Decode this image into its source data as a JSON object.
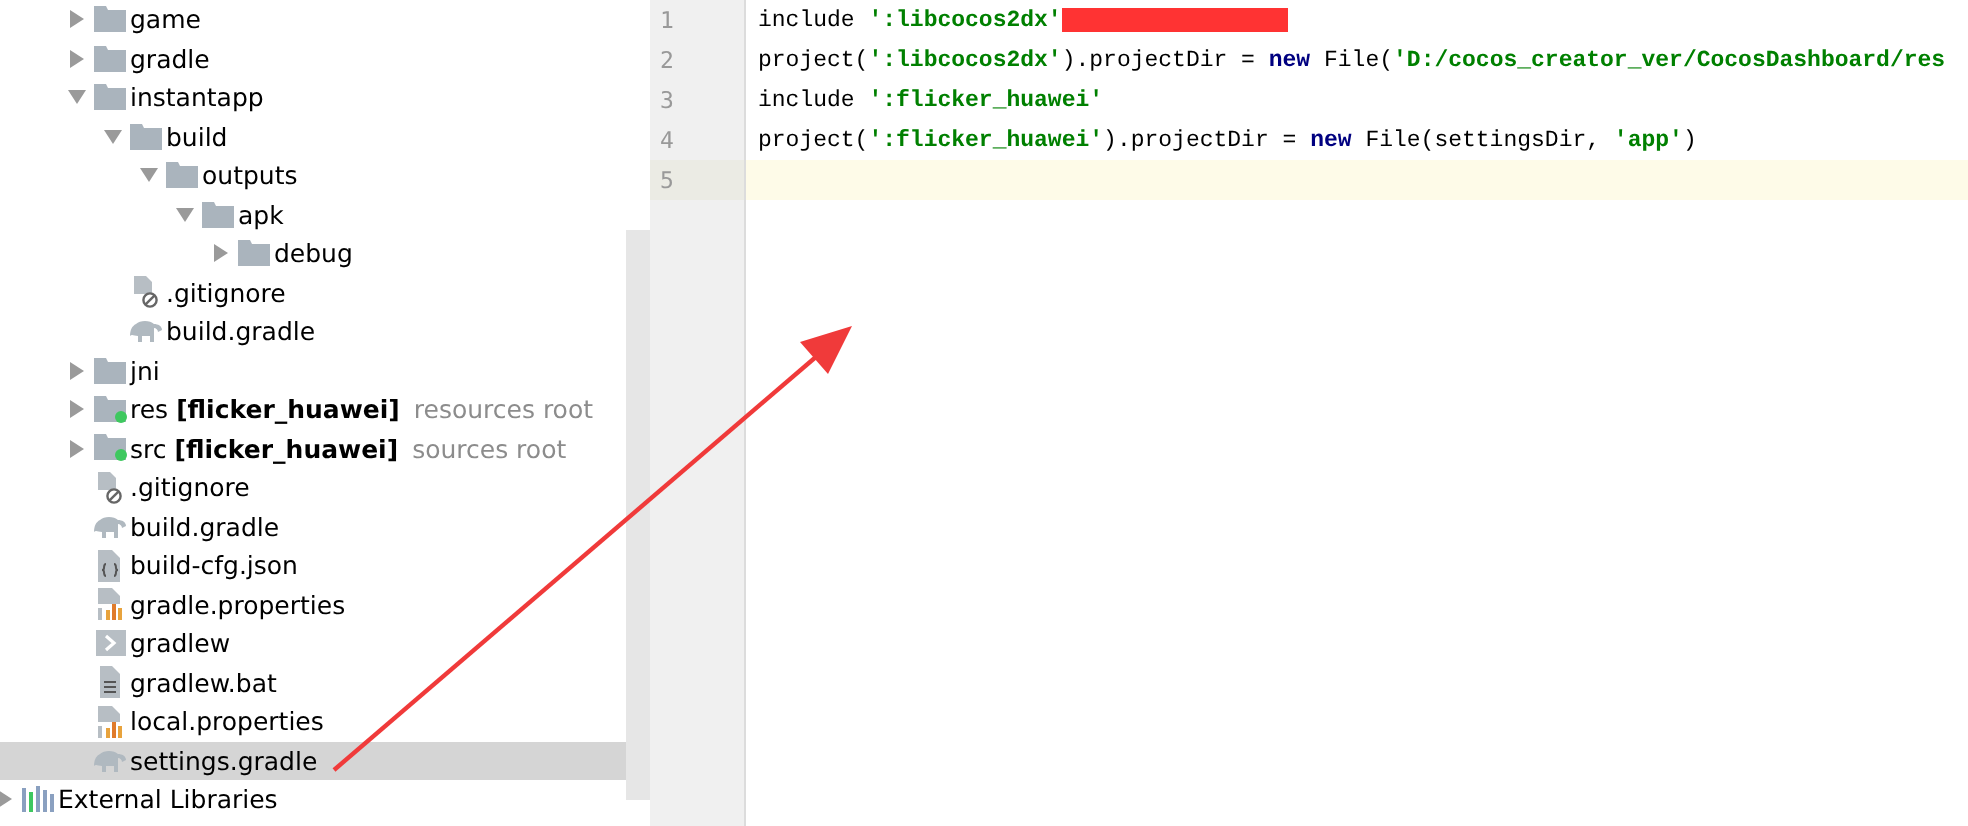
{
  "project_tree": {
    "items": [
      {
        "label": "game",
        "kind": "folder",
        "expanded": false,
        "selected": false
      },
      {
        "label": "gradle",
        "kind": "folder",
        "expanded": false,
        "selected": false
      },
      {
        "label": "instantapp",
        "kind": "folder",
        "expanded": true,
        "selected": false,
        "children": [
          {
            "label": "build",
            "kind": "folder",
            "expanded": true,
            "selected": false,
            "children": [
              {
                "label": "outputs",
                "kind": "folder",
                "expanded": true,
                "selected": false,
                "children": [
                  {
                    "label": "apk",
                    "kind": "folder",
                    "expanded": true,
                    "selected": false,
                    "children": [
                      {
                        "label": "debug",
                        "kind": "folder",
                        "expanded": false,
                        "selected": false
                      }
                    ]
                  }
                ]
              }
            ]
          },
          {
            "label": ".gitignore",
            "kind": "ignore",
            "selected": false
          },
          {
            "label": "build.gradle",
            "kind": "gradle",
            "selected": false
          }
        ]
      },
      {
        "label": "jni",
        "kind": "folder",
        "expanded": false,
        "selected": false
      },
      {
        "label": "res",
        "kind": "source-folder",
        "expanded": false,
        "selected": false,
        "module": "[flicker_huawei]",
        "hint": "resources root"
      },
      {
        "label": "src",
        "kind": "source-folder",
        "expanded": false,
        "selected": false,
        "module": "[flicker_huawei]",
        "hint": "sources root"
      },
      {
        "label": ".gitignore",
        "kind": "ignore",
        "selected": false
      },
      {
        "label": "build.gradle",
        "kind": "gradle",
        "selected": false
      },
      {
        "label": "build-cfg.json",
        "kind": "json",
        "selected": false
      },
      {
        "label": "gradle.properties",
        "kind": "properties",
        "selected": false
      },
      {
        "label": "gradlew",
        "kind": "shell",
        "selected": false
      },
      {
        "label": "gradlew.bat",
        "kind": "text",
        "selected": false
      },
      {
        "label": "local.properties",
        "kind": "properties",
        "selected": false
      },
      {
        "label": "settings.gradle",
        "kind": "gradle",
        "selected": true
      }
    ],
    "external": {
      "label": "External Libraries",
      "expanded": false
    }
  },
  "editor": {
    "lines": [
      {
        "number": "1",
        "current": false,
        "segments": [
          {
            "kind": "plain",
            "text": "include "
          },
          {
            "kind": "string",
            "text": "':libcocos2dx'"
          },
          {
            "kind": "redacted"
          }
        ]
      },
      {
        "number": "2",
        "current": false,
        "segments": [
          {
            "kind": "plain",
            "text": "project("
          },
          {
            "kind": "string",
            "text": "':libcocos2dx'"
          },
          {
            "kind": "plain",
            "text": ").projectDir = "
          },
          {
            "kind": "keyword",
            "text": "new"
          },
          {
            "kind": "plain",
            "text": " File("
          },
          {
            "kind": "string",
            "text": "'D:/cocos_creator_ver/CocosDashboard/res"
          }
        ]
      },
      {
        "number": "3",
        "current": false,
        "segments": [
          {
            "kind": "plain",
            "text": "include "
          },
          {
            "kind": "string",
            "text": "':flicker_huawei'"
          }
        ]
      },
      {
        "number": "4",
        "current": false,
        "segments": [
          {
            "kind": "plain",
            "text": "project("
          },
          {
            "kind": "string",
            "text": "':flicker_huawei'"
          },
          {
            "kind": "plain",
            "text": ").projectDir = "
          },
          {
            "kind": "keyword",
            "text": "new"
          },
          {
            "kind": "plain",
            "text": " File(settingsDir, "
          },
          {
            "kind": "string",
            "text": "'app'"
          },
          {
            "kind": "plain",
            "text": ")"
          }
        ]
      },
      {
        "number": "5",
        "current": true
      }
    ]
  }
}
